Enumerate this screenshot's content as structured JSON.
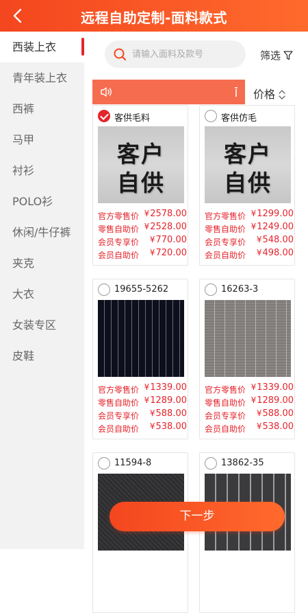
{
  "header": {
    "title": "远程自助定制-面料款式"
  },
  "sidebar": {
    "items": [
      {
        "label": "西装上衣",
        "active": true
      },
      {
        "label": "青年装上衣"
      },
      {
        "label": "西裤"
      },
      {
        "label": "马甲"
      },
      {
        "label": "衬衫"
      },
      {
        "label": "POLO衫"
      },
      {
        "label": "休闲/牛仔裤"
      },
      {
        "label": "夹克"
      },
      {
        "label": "大衣"
      },
      {
        "label": "女装专区"
      },
      {
        "label": "皮鞋"
      }
    ]
  },
  "search": {
    "placeholder": "请输入面料及款号"
  },
  "filter": {
    "label": "筛选"
  },
  "sort": {
    "label": "价格"
  },
  "price_labels": [
    "官方零售价",
    "零售自助价",
    "会员专享价",
    "会员自助价"
  ],
  "currency": "¥",
  "products": [
    {
      "name": "客供毛料",
      "checked": true,
      "thumb": "supplied",
      "thumb_text": [
        "客户",
        "自供"
      ],
      "prices": [
        "2578.00",
        "2528.00",
        "770.00",
        "720.00"
      ]
    },
    {
      "name": "客供仿毛",
      "checked": false,
      "thumb": "supplied",
      "thumb_text": [
        "客户",
        "自供"
      ],
      "prices": [
        "1299.00",
        "1249.00",
        "548.00",
        "498.00"
      ]
    },
    {
      "name": "19655-5262",
      "checked": false,
      "thumb": "navy",
      "prices": [
        "1339.00",
        "1289.00",
        "588.00",
        "538.00"
      ]
    },
    {
      "name": "16263-3",
      "checked": false,
      "thumb": "grey",
      "prices": [
        "1339.00",
        "1289.00",
        "588.00",
        "538.00"
      ]
    },
    {
      "name": "11594-8",
      "checked": false,
      "thumb": "charcoal"
    },
    {
      "name": "13862-35",
      "checked": false,
      "thumb": "stripe"
    }
  ],
  "next_button": {
    "label": "下一步"
  },
  "colors": {
    "accent": "#f4461f",
    "price_red": "#e5242b",
    "notice_bar": "#f56c4f",
    "sidebar_bg": "#f2f2f2"
  },
  "icons": [
    "back-arrow-icon",
    "search-icon",
    "filter-funnel-icon",
    "speaker-icon",
    "sort-arrows-icon",
    "check-icon"
  ]
}
